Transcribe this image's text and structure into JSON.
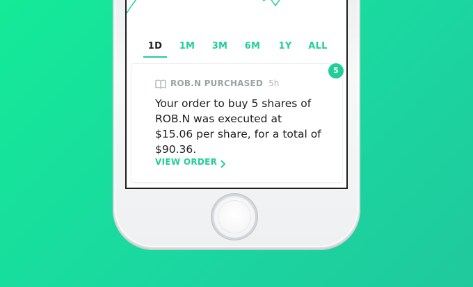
{
  "colors": {
    "accent": "#21ce99",
    "background": "#14ea98",
    "text": "#1e1e1e",
    "muted": "#9aa3a6"
  },
  "chart": {
    "line_color": "#21ce99"
  },
  "range_tabs": [
    {
      "label": "1D",
      "active": true
    },
    {
      "label": "1M",
      "active": false
    },
    {
      "label": "3M",
      "active": false
    },
    {
      "label": "6M",
      "active": false
    },
    {
      "label": "1Y",
      "active": false
    },
    {
      "label": "ALL",
      "active": false
    }
  ],
  "notification": {
    "badge_count": "5",
    "icon": "book-icon",
    "title": "ROB.N PURCHASED",
    "time": "5h",
    "body": "Your order to buy 5 shares of ROB.N was executed at $15.06 per share, for a total of $90.36.",
    "link_label": "VIEW ORDER",
    "link_icon": "chevron-right-icon"
  },
  "device": {
    "home_button_icon": "home-button"
  }
}
